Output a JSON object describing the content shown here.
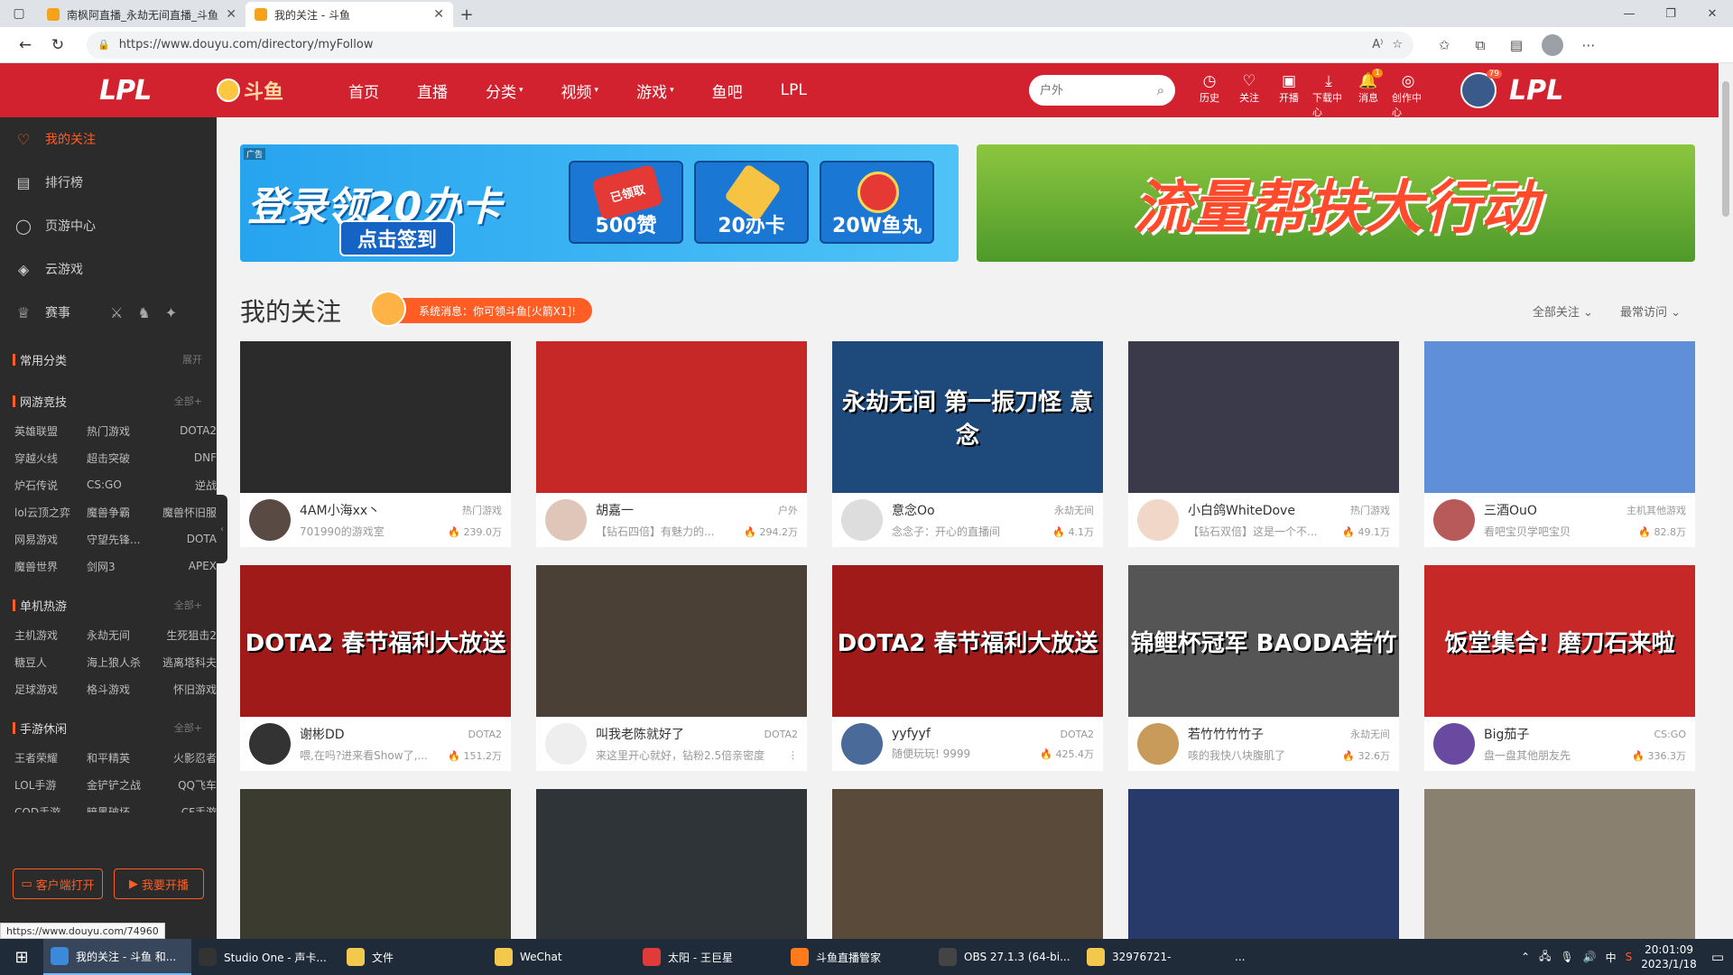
{
  "browser": {
    "tabs": [
      {
        "title": "南枫阿直播_永劫无间直播_斗鱼",
        "active": false
      },
      {
        "title": "我的关注 - 斗鱼",
        "active": true
      }
    ],
    "url": "https://www.douyu.com/directory/myFollow",
    "reader_label": "A⁾"
  },
  "header": {
    "logo_text": "LPL",
    "douyu_text": "斗鱼",
    "nav": [
      {
        "label": "首页"
      },
      {
        "label": "直播"
      },
      {
        "label": "分类",
        "caret": "▾"
      },
      {
        "label": "视频",
        "caret": "▾"
      },
      {
        "label": "游戏",
        "caret": "▾"
      },
      {
        "label": "鱼吧"
      },
      {
        "label": "LPL"
      }
    ],
    "search_placeholder": "户外",
    "icons": [
      {
        "label": "历史",
        "glyph": "◷"
      },
      {
        "label": "关注",
        "glyph": "♡"
      },
      {
        "label": "开播",
        "glyph": "▣"
      },
      {
        "label": "下载中心",
        "glyph": "⤓"
      },
      {
        "label": "消息",
        "glyph": "🔔",
        "badge": "1"
      },
      {
        "label": "创作中心",
        "glyph": "◎"
      }
    ],
    "avatar_level": "79"
  },
  "sidebar": {
    "items": [
      {
        "label": "我的关注",
        "icon": "♡",
        "active": true
      },
      {
        "label": "排行榜",
        "icon": "▤"
      },
      {
        "label": "页游中心",
        "icon": "◯"
      },
      {
        "label": "云游戏",
        "icon": "◈"
      },
      {
        "label": "赛事",
        "icon": "♕"
      }
    ],
    "event_icons": [
      "⚔",
      "♞",
      "✦"
    ],
    "sections": [
      {
        "title": "常用分类",
        "more": "展开",
        "items": []
      },
      {
        "title": "网游竞技",
        "more": "全部+",
        "items": [
          "英雄联盟",
          "热门游戏",
          "DOTA2",
          "穿越火线",
          "超击突破",
          "DNF",
          "炉石传说",
          "CS:GO",
          "逆战",
          "lol云顶之弈",
          "魔兽争霸",
          "魔兽怀旧服",
          "网易游戏",
          "守望先锋...",
          "DOTA",
          "魔兽世界",
          "剑网3",
          "APEX"
        ]
      },
      {
        "title": "单机热游",
        "more": "全部+",
        "items": [
          "主机游戏",
          "永劫无间",
          "生死狙击2",
          "糖豆人",
          "海上狼人杀",
          "逃离塔科夫",
          "足球游戏",
          "格斗游戏",
          "怀旧游戏"
        ]
      },
      {
        "title": "手游休闲",
        "more": "全部+",
        "items": [
          "王者荣耀",
          "和平精英",
          "火影忍者",
          "LOL手游",
          "金铲铲之战",
          "QQ飞车",
          "COD手游",
          "暗黑破坏...",
          "CF手游"
        ]
      }
    ],
    "buttons": [
      {
        "label": "客户端打开",
        "icon": "▭"
      },
      {
        "label": "我要开播",
        "icon": "▶"
      }
    ]
  },
  "banners": {
    "left": {
      "ad": "广告",
      "headline": "登录领20办卡",
      "button": "点击签到",
      "cards": [
        "500赞",
        "20办卡",
        "20W鱼丸"
      ],
      "stamp": "已领取"
    },
    "right": {
      "headline": "流量帮扶大行动"
    }
  },
  "main": {
    "title": "我的关注",
    "system_message": "系统消息：你可领斗鱼[火箭X1]!",
    "filter_all": "全部关注",
    "filter_sort": "最常访问",
    "cards": [
      {
        "name": "4AM小海xx丶",
        "category": "热门游戏",
        "room": "701990的游戏室",
        "hot": "239.0万",
        "thumb_color": "#2b2b2b",
        "avatar_color": "#5a4a44",
        "thumb_text": ""
      },
      {
        "name": "胡嘉一",
        "category": "户外",
        "room": "【钻石四倍】有魅力的...",
        "hot": "294.2万",
        "thumb_color": "#c62828",
        "avatar_color": "#e0c6b8",
        "thumb_text": ""
      },
      {
        "name": "意念Oo",
        "category": "永劫无间",
        "room": "念念子：开心的直播间",
        "hot": "4.1万",
        "thumb_color": "#1d4a7a",
        "avatar_color": "#dddddd",
        "thumb_text": "永劫无间 第一振刀怪 意念"
      },
      {
        "name": "小白鸽WhiteDove",
        "category": "热门游戏",
        "room": "【钻石双倍】这是一个不...",
        "hot": "49.1万",
        "thumb_color": "#3a3a4a",
        "avatar_color": "#f1d7c8",
        "thumb_text": ""
      },
      {
        "name": "三酒OuO",
        "category": "主机其他游戏",
        "room": "看吧宝贝学吧宝贝",
        "hot": "82.8万",
        "thumb_color": "#5f8fd8",
        "avatar_color": "#b85a5a",
        "thumb_text": ""
      },
      {
        "name": "谢彬DD",
        "category": "DOTA2",
        "room": "喂,在吗?进来看Show了,...",
        "hot": "151.2万",
        "thumb_color": "#a11a1a",
        "avatar_color": "#333333",
        "thumb_text": "DOTA2 春节福利大放送"
      },
      {
        "name": "叫我老陈就好了",
        "category": "DOTA2",
        "room": "来这里开心就好，钻粉2.5倍亲密度",
        "hot": "",
        "thumb_color": "#4a4036",
        "avatar_color": "#eeeeee",
        "thumb_text": ""
      },
      {
        "name": "yyfyyf",
        "category": "DOTA2",
        "room": "随便玩玩! 9999",
        "hot": "425.4万",
        "thumb_color": "#a11a1a",
        "avatar_color": "#4a6a9a",
        "thumb_text": "DOTA2 春节福利大放送"
      },
      {
        "name": "若竹竹竹竹子",
        "category": "永劫无间",
        "room": "咳的我快八块腹肌了",
        "hot": "32.6万",
        "thumb_color": "#555555",
        "avatar_color": "#c89b5a",
        "thumb_text": "锦鲤杯冠军 BAODA若竹"
      },
      {
        "name": "Big茄子",
        "category": "CS:GO",
        "room": "盘一盘其他朋友先",
        "hot": "336.3万",
        "thumb_color": "#c62828",
        "avatar_color": "#6a4aa0",
        "thumb_text": "饭堂集合! 磨刀石来啦"
      },
      {
        "name": "",
        "category": "",
        "room": "",
        "hot": "",
        "thumb_color": "#3b3b2f",
        "avatar_color": "#ffffff",
        "thumb_text": ""
      },
      {
        "name": "",
        "category": "",
        "room": "",
        "hot": "",
        "thumb_color": "#2f3438",
        "avatar_color": "#ffffff",
        "thumb_text": ""
      },
      {
        "name": "",
        "category": "",
        "room": "",
        "hot": "",
        "thumb_color": "#5a4a3a",
        "avatar_color": "#ffffff",
        "thumb_text": ""
      },
      {
        "name": "",
        "category": "",
        "room": "",
        "hot": "",
        "thumb_color": "#283a6a",
        "avatar_color": "#ffffff",
        "thumb_text": ""
      },
      {
        "name": "",
        "category": "",
        "room": "",
        "hot": "",
        "thumb_color": "#8a8070",
        "avatar_color": "#ffffff",
        "thumb_text": ""
      }
    ]
  },
  "status_url": "https://www.douyu.com/74960",
  "taskbar": {
    "items": [
      {
        "label": "我的关注 - 斗鱼 和...",
        "color": "#3b8ad9",
        "active": true
      },
      {
        "label": "Studio One - 声卡...",
        "color": "#333333"
      },
      {
        "label": "文件",
        "color": "#f2c94c"
      },
      {
        "label": "WeChat",
        "color": "#f2c94c"
      },
      {
        "label": "太阳 - 王巨星",
        "color": "#e03a3a"
      },
      {
        "label": "斗鱼直播管家",
        "color": "#ff7a1a"
      },
      {
        "label": "OBS 27.1.3 (64-bi...",
        "color": "#444444"
      },
      {
        "label": "32976721-",
        "color": "#f2c94c"
      }
    ],
    "overflow": "...",
    "tray": {
      "ime": "中",
      "time": "20:01:09",
      "date": "2023/1/18"
    }
  }
}
